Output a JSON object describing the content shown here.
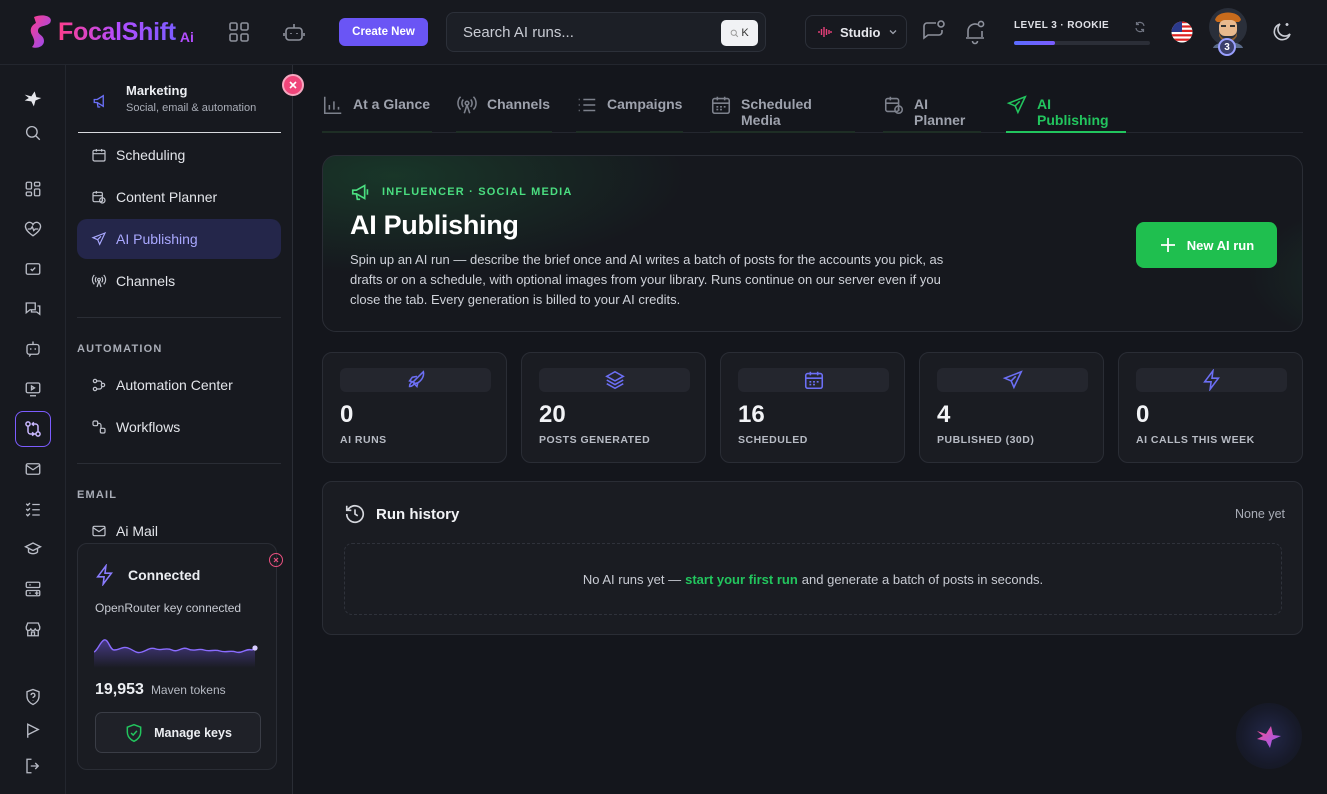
{
  "header": {
    "brand": "FocalShift",
    "brand_suffix": "Ai",
    "create_label": "Create New",
    "search_placeholder": "Search AI runs...",
    "search_shortcut": "K",
    "workspace": "Studio",
    "level_label": "LEVEL 3 · ROOKIE",
    "level_progress": 0.3,
    "avatar_level": "3"
  },
  "subnav": {
    "group_title": "Marketing",
    "group_subtitle": "Social, email & automation",
    "items": [
      {
        "label": "Scheduling"
      },
      {
        "label": "Content Planner"
      },
      {
        "label": "AI Publishing"
      },
      {
        "label": "Channels"
      }
    ],
    "automation_label": "AUTOMATION",
    "automation_items": [
      {
        "label": "Automation Center"
      },
      {
        "label": "Workflows"
      }
    ],
    "email_label": "EMAIL",
    "email_items": [
      {
        "label": "Ai Mail"
      }
    ]
  },
  "connection": {
    "title": "Connected",
    "subtitle": "OpenRouter key connected",
    "tokens": "19,953",
    "tokens_label": "Maven tokens",
    "manage_label": "Manage keys"
  },
  "tabs": [
    {
      "label": "At a Glance"
    },
    {
      "label": "Channels"
    },
    {
      "label": "Campaigns"
    },
    {
      "label": "Scheduled Media"
    },
    {
      "label": "AI Planner"
    },
    {
      "label": "AI Publishing"
    }
  ],
  "hero": {
    "eyebrow": "INFLUENCER · SOCIAL MEDIA",
    "title": "AI Publishing",
    "description": "Spin up an AI run — describe the brief once and AI writes a batch of posts for the accounts you pick, as drafts or on a schedule, with optional images from your library. Runs continue on our server even if you close the tab. Every generation is billed to your AI credits.",
    "cta": "New AI run"
  },
  "stats": [
    {
      "value": "0",
      "label": "AI RUNS",
      "icon": "rocket-icon"
    },
    {
      "value": "20",
      "label": "POSTS GENERATED",
      "icon": "layers-icon"
    },
    {
      "value": "16",
      "label": "SCHEDULED",
      "icon": "calendar-icon"
    },
    {
      "value": "4",
      "label": "PUBLISHED (30D)",
      "icon": "send-icon"
    },
    {
      "value": "0",
      "label": "AI CALLS THIS WEEK",
      "icon": "bolt-icon"
    }
  ],
  "history": {
    "title": "Run history",
    "status": "None yet",
    "empty_prefix": "No AI runs yet —",
    "empty_link": "start your first run",
    "empty_suffix": "and generate a batch of posts in seconds."
  },
  "colors": {
    "accent": "#6a55f5",
    "success": "#22c55e",
    "background": "#14161c"
  }
}
